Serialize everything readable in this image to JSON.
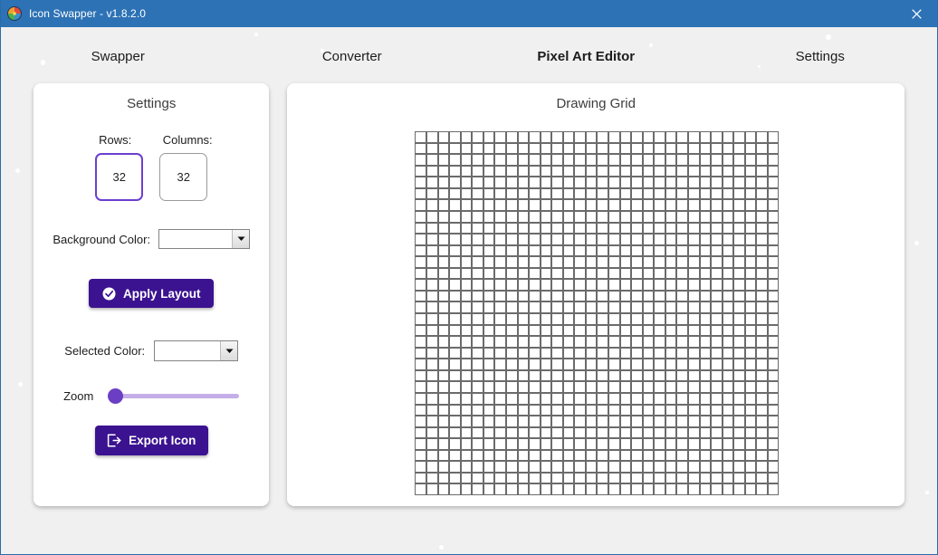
{
  "window": {
    "title": "Icon Swapper - v1.8.2.0",
    "app_icon": "app-circle-icon",
    "close_label": "✕",
    "border_color": "#2a6aa8",
    "titlebar_color": "#2d72b5",
    "background_color": "#f0f0f0"
  },
  "tabs": [
    {
      "label": "Swapper",
      "active": false
    },
    {
      "label": "Converter",
      "active": false
    },
    {
      "label": "Pixel Art Editor",
      "active": true
    },
    {
      "label": "Settings",
      "active": false
    }
  ],
  "accent": {
    "tab_underline": "#5b3bb0",
    "button_purple": "#3b1390",
    "focus_border": "#6c3fd0",
    "slider_thumb": "#6b3fc4",
    "slider_track": "#c4aee8"
  },
  "settings_panel": {
    "title": "Settings",
    "rows": {
      "label": "Rows:",
      "value": "32",
      "focused": true
    },
    "columns": {
      "label": "Columns:",
      "value": "32",
      "focused": false
    },
    "background_color": {
      "label": "Background Color:",
      "value": "",
      "swatch_color": "#ffffff"
    },
    "apply_button": {
      "label": "Apply Layout",
      "icon": "check-circle-icon"
    },
    "selected_color": {
      "label": "Selected Color:",
      "value": "",
      "swatch_color": "#000000"
    },
    "zoom": {
      "label": "Zoom",
      "value": 0,
      "min": 0,
      "max": 100
    },
    "export_button": {
      "label": "Export Icon",
      "icon": "export-arrow-icon"
    }
  },
  "drawing_panel": {
    "title": "Drawing Grid",
    "grid": {
      "rows": 32,
      "columns": 32,
      "cell_color": "#ffffff",
      "line_color": "#6b6b6b"
    }
  }
}
